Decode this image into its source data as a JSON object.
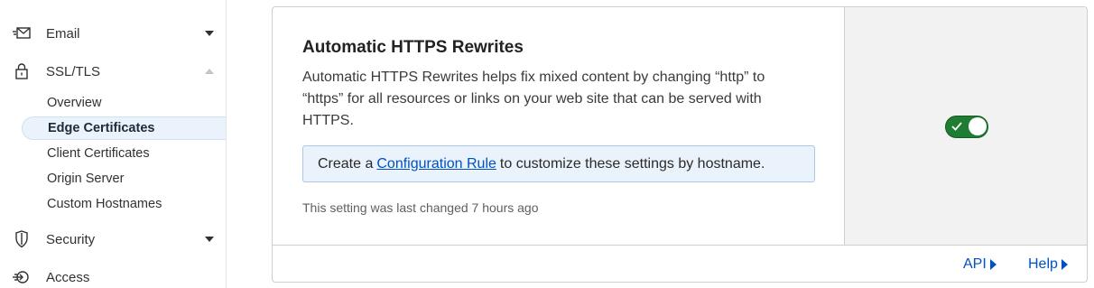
{
  "sidebar": {
    "items": [
      {
        "label": "Email",
        "icon": "email-icon",
        "expanded": false
      },
      {
        "label": "SSL/TLS",
        "icon": "lock-icon",
        "expanded": true
      },
      {
        "label": "Security",
        "icon": "shield-icon",
        "expanded": false
      },
      {
        "label": "Access",
        "icon": "access-icon",
        "expanded": false
      }
    ],
    "ssl_sub_items": [
      {
        "label": "Overview",
        "active": false
      },
      {
        "label": "Edge Certificates",
        "active": true
      },
      {
        "label": "Client Certificates",
        "active": false
      },
      {
        "label": "Origin Server",
        "active": false
      },
      {
        "label": "Custom Hostnames",
        "active": false
      }
    ]
  },
  "card": {
    "title": "Automatic HTTPS Rewrites",
    "description": "Automatic HTTPS Rewrites helps fix mixed content by changing “http” to “https” for all resources or links on your web site that can be served with HTTPS.",
    "callout": {
      "prefix": "Create a",
      "link": "Configuration Rule",
      "suffix": "to customize these settings by hostname."
    },
    "last_changed": "This setting was last changed 7 hours ago",
    "toggle_on": true,
    "footer": {
      "api_label": "API",
      "help_label": "Help"
    }
  },
  "colors": {
    "accent_link": "#0051c3",
    "toggle_on": "#1e7d32",
    "callout_bg": "#eaf2fb",
    "active_nav_bg": "#eaf2fb"
  }
}
